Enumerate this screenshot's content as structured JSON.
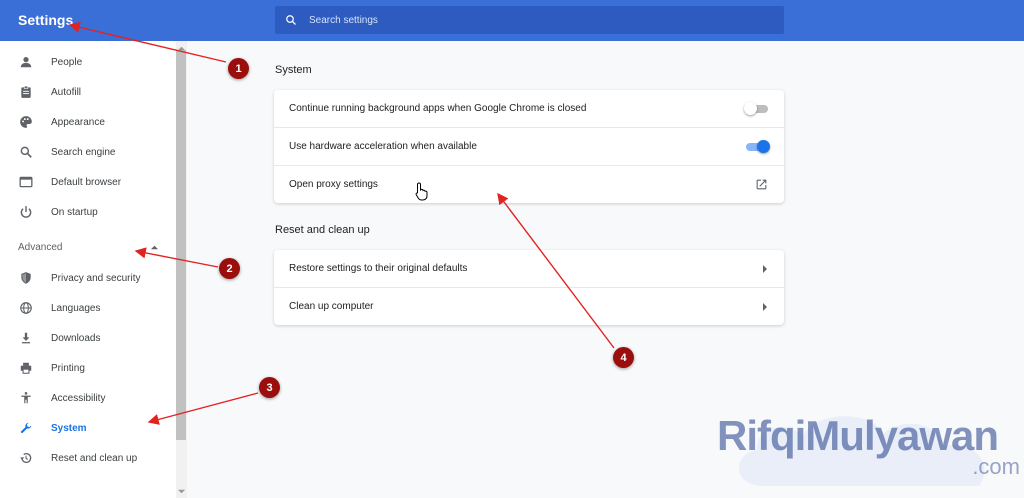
{
  "header": {
    "title": "Settings",
    "search_placeholder": "Search settings",
    "bar_color": "#3a6fd8"
  },
  "sidebar": {
    "items": [
      {
        "label": "People",
        "icon": "person-icon"
      },
      {
        "label": "Autofill",
        "icon": "clipboard-icon"
      },
      {
        "label": "Appearance",
        "icon": "palette-icon"
      },
      {
        "label": "Search engine",
        "icon": "search-icon"
      },
      {
        "label": "Default browser",
        "icon": "browser-window-icon"
      },
      {
        "label": "On startup",
        "icon": "power-icon"
      }
    ],
    "advanced_label": "Advanced",
    "advanced_items": [
      {
        "label": "Privacy and security",
        "icon": "shield-icon"
      },
      {
        "label": "Languages",
        "icon": "globe-icon"
      },
      {
        "label": "Downloads",
        "icon": "download-icon"
      },
      {
        "label": "Printing",
        "icon": "printer-icon"
      },
      {
        "label": "Accessibility",
        "icon": "accessibility-icon"
      },
      {
        "label": "System",
        "icon": "wrench-icon",
        "active": true
      },
      {
        "label": "Reset and clean up",
        "icon": "restore-icon"
      }
    ]
  },
  "main": {
    "system": {
      "title": "System",
      "rows": [
        {
          "label": "Continue running background apps when Google Chrome is closed",
          "control": "toggle",
          "state": "off"
        },
        {
          "label": "Use hardware acceleration when available",
          "control": "toggle",
          "state": "on"
        },
        {
          "label": "Open proxy settings",
          "control": "external-link-icon"
        }
      ]
    },
    "reset": {
      "title": "Reset and clean up",
      "rows": [
        {
          "label": "Restore settings to their original defaults",
          "control": "arrow-right-icon"
        },
        {
          "label": "Clean up computer",
          "control": "arrow-right-icon"
        }
      ]
    }
  },
  "annotations": {
    "markers": [
      "1",
      "2",
      "3",
      "4"
    ],
    "color": "#9b0e0e"
  },
  "watermark": {
    "text": "RifqiMulyawan",
    "suffix": ".com"
  },
  "colors": {
    "accent": "#1a73e8",
    "page_bg": "#f8f9fb"
  }
}
